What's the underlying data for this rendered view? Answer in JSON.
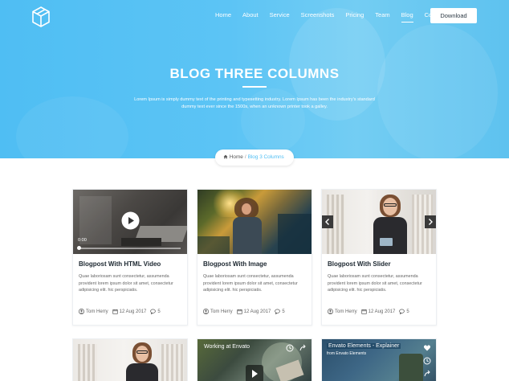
{
  "header": {
    "nav": [
      "Home",
      "About",
      "Service",
      "Screenshots",
      "Pricing",
      "Team",
      "Blog",
      "Contact"
    ],
    "active_nav": "Blog",
    "download_label": "Download",
    "title": "BLOG THREE COLUMNS",
    "description": "Lorem Ipsum is simply dummy text of the printing and typesetting industry. Lorem Ipsum has been the industry's standard dummy text ever since the 1500s, when an unknown printer took a galley."
  },
  "breadcrumb": {
    "home": "Home",
    "separator": "/",
    "current": "Blog 3 Columns"
  },
  "colors": {
    "accent": "#4fbef3",
    "title": "#1c2730"
  },
  "cards": [
    {
      "title": "Blogpost With HTML Video",
      "description": "Quae laboriosam sunt consectetur, assumenda provident lorem ipsum dolor sit amet, consectetur adipisicing elit. hic perspiciatis.",
      "author": "Tom Herry",
      "date": "12 Aug 2017",
      "comments": "5",
      "video_time": "0:00",
      "media": "video"
    },
    {
      "title": "Blogpost With Image",
      "description": "Quae laboriosam sunt consectetur, assumenda provident lorem ipsum dolor sit amet, consectetur adipisicing elit. hic perspiciatis.",
      "author": "Tom Herry",
      "date": "12 Aug 2017",
      "comments": "5",
      "media": "image"
    },
    {
      "title": "Blogpost With Slider",
      "description": "Quae laboriosam sunt consectetur, assumenda provident lorem ipsum dolor sit amet, consectetur adipisicing elit. hic perspiciatis.",
      "author": "Tom Herry",
      "date": "12 Aug 2017",
      "comments": "5",
      "media": "slider"
    }
  ],
  "bottom_cards": [
    {
      "media": "image"
    },
    {
      "media": "video",
      "label": "Working at Envato"
    },
    {
      "media": "video",
      "label": "Envato Elements - Explainer",
      "sublabel": "from Envato Elements"
    }
  ]
}
